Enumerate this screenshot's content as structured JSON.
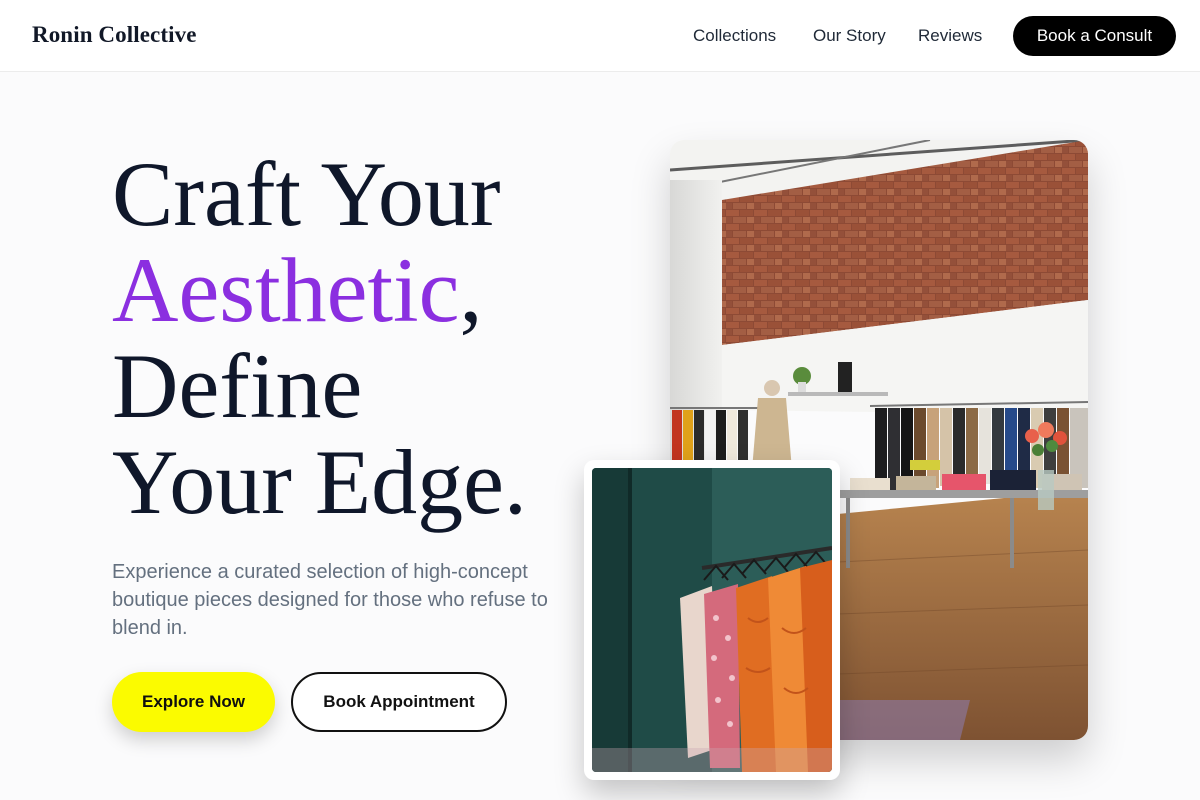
{
  "nav": {
    "brand": "Ronin Collective",
    "links": [
      "Collections",
      "Our Story",
      "Reviews"
    ],
    "cta": "Book a Consult"
  },
  "hero": {
    "headline": {
      "line1": "Craft Your",
      "accent_word": "Aesthetic",
      "accent_suffix": ",",
      "line3": "Define",
      "line4": "Your Edge."
    },
    "subtext": "Experience a curated selection of high-concept boutique pieces designed for those who refuse to blend in.",
    "primary_button": "Explore Now",
    "secondary_button": "Book Appointment"
  },
  "images": {
    "main": "boutique-interior-photo",
    "inset": "clothing-rack-photo"
  },
  "colors": {
    "accent": "#8b2fe0",
    "primary_button": "#fbfb00",
    "nav_cta": "#000000",
    "headline": "#0f172a",
    "subtext": "#64707f"
  }
}
